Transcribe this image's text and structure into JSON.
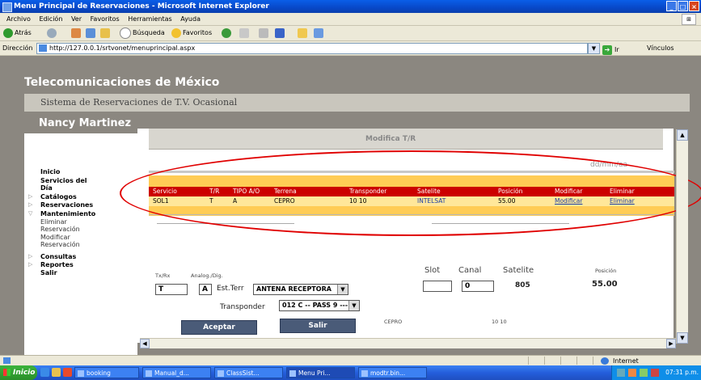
{
  "window": {
    "title": "Menu Principal de Reservaciones - Microsoft Internet Explorer",
    "buttons": [
      "_",
      "□",
      "×"
    ]
  },
  "menubar": [
    "Archivo",
    "Edición",
    "Ver",
    "Favoritos",
    "Herramientas",
    "Ayuda"
  ],
  "toolbar": {
    "back": "Atrás",
    "search": "Búsqueda",
    "favorites": "Favoritos"
  },
  "addressbar": {
    "label": "Dirección",
    "url": "http://127.0.0.1/srtvonet/menuprincipal.aspx",
    "go": "Ir",
    "links": "Vínculos"
  },
  "page": {
    "org_title": "Telecomunicaciones de México",
    "system_title": "Sistema de Reservaciones de T.V. Ocasional",
    "user_name": "Nancy Martinez"
  },
  "nav": {
    "inicio": "Inicio",
    "servicios_del": "Servicios del",
    "dia": "Día",
    "catalogos": "Catálogos",
    "reservaciones": "Reservaciones",
    "mantenimiento": "Mantenimiento",
    "eliminar": "Eliminar",
    "reservacion1": "Reservación",
    "modificar": "Modificar",
    "reservacion2": "Reservación",
    "consultas": "Consultas",
    "reportes": "Reportes",
    "salir": "Salir"
  },
  "panel": {
    "heading": "Modifica T/R",
    "ghost_date": "dd/mm/aa"
  },
  "grid": {
    "headers": [
      "Servicio",
      "T/R",
      "TIPO A/O",
      "Terrena",
      "Transponder",
      "Satelite",
      "Posición",
      "Modificar",
      "Eliminar"
    ],
    "row": {
      "servicio": "SOL1",
      "tr": "T",
      "tipo": "A",
      "terrena": "CEPRO",
      "transponder": "10 10",
      "satelite": "INTELSAT",
      "posicion": "55.00",
      "modificar": "Modificar",
      "eliminar": "Eliminar"
    }
  },
  "form": {
    "tx_rx_label": "Tx/Rx",
    "tx_rx_value": "T",
    "analog_label": "Analog./Dig.",
    "analog_value": "A",
    "est_terr_label": "Est.Terr",
    "est_terr_value": "ANTENA RECEPTORA",
    "slot_label": "Slot",
    "slot_value": "",
    "canal_label": "Canal",
    "canal_value": "0",
    "satelite_label": "Satelite",
    "satelite_value": "805",
    "posicion_label": "Posición",
    "posicion_value": "55.00",
    "transponder_label": "Transponder",
    "transponder_value": "012 C -- PASS 9 ---",
    "aceptar": "Aceptar",
    "salir": "Salir",
    "terrena_text": "CEPRO",
    "transponder_text": "10 10"
  },
  "status": {
    "zone": "Internet"
  },
  "taskbar": {
    "start": "Inicio",
    "tasks": [
      "booking",
      "Manual_d...",
      "ClassSist...",
      "Menu Pri...",
      "modtr.bin..."
    ],
    "clock": "07:31 p.m."
  }
}
